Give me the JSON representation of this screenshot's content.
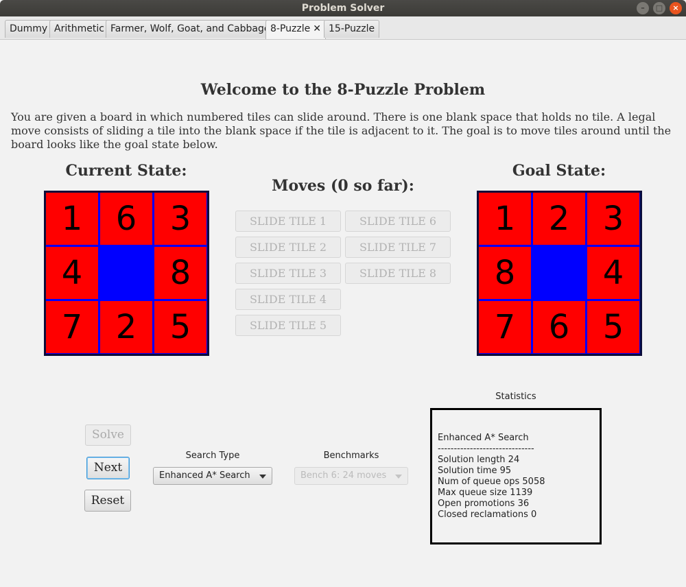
{
  "window": {
    "title": "Problem Solver",
    "buttons": {
      "minimize": "–",
      "maximize": "□",
      "close": "×"
    }
  },
  "tabs": [
    {
      "label": "Dummy"
    },
    {
      "label": "Arithmetic"
    },
    {
      "label": "Farmer, Wolf, Goat, and Cabbage"
    },
    {
      "label": "8-Puzzle",
      "active": true,
      "close": "✕"
    },
    {
      "label": "15-Puzzle"
    }
  ],
  "main": {
    "heading": "Welcome to the 8-Puzzle Problem",
    "description": "You are given a board in which numbered tiles can slide around. There is one blank space that holds no tile.  A legal move consists of sliding a tile into the blank space if the tile is adjacent to it. The goal is to move tiles around until the board looks like the goal state below."
  },
  "current_state": {
    "title": "Current State:",
    "tiles": [
      "1",
      "6",
      "3",
      "4",
      "",
      "8",
      "7",
      "2",
      "5"
    ]
  },
  "goal_state": {
    "title": "Goal State:",
    "tiles": [
      "1",
      "2",
      "3",
      "8",
      "",
      "4",
      "7",
      "6",
      "5"
    ]
  },
  "moves": {
    "title": "Moves (0 so far):",
    "buttons": [
      "SLIDE TILE 1",
      "SLIDE TILE 2",
      "SLIDE TILE 3",
      "SLIDE TILE 4",
      "SLIDE TILE 5",
      "SLIDE TILE 6",
      "SLIDE TILE 7",
      "SLIDE TILE 8"
    ]
  },
  "controls": {
    "solve": "Solve",
    "next": "Next",
    "reset": "Reset",
    "search_type_label": "Search Type",
    "search_type_value": "Enhanced A* Search",
    "benchmarks_label": "Benchmarks",
    "benchmarks_value": "Bench 6: 24 moves"
  },
  "statistics": {
    "label": "Statistics",
    "method": "Enhanced A* Search",
    "separator": "------------------------------",
    "rows": [
      {
        "name": "Solution length",
        "value": "24"
      },
      {
        "name": "Solution time",
        "value": "95"
      },
      {
        "name": "Num of queue ops",
        "value": "5058"
      },
      {
        "name": "Max queue size",
        "value": "1139"
      },
      {
        "name": "Open promotions",
        "value": "36"
      },
      {
        "name": "Closed reclamations",
        "value": "0"
      }
    ]
  },
  "colors": {
    "tile": "#ff0000",
    "blank": "#0000ff",
    "board_border": "#0d0d3a"
  }
}
